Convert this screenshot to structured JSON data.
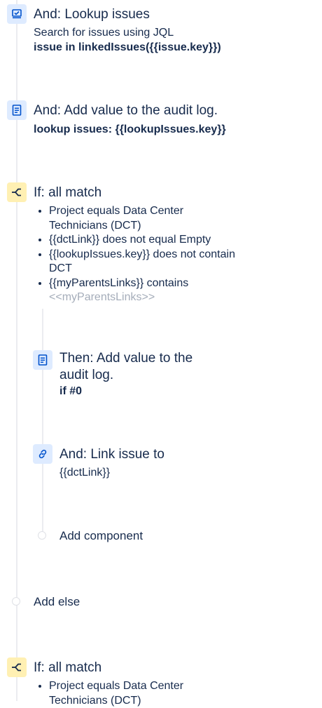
{
  "blocks": {
    "lookup": {
      "title": "And: Lookup issues",
      "subtitle": "Search for issues using JQL",
      "query": "issue in linkedIssues({{issue.key}})",
      "icon": "lookup-issues-icon"
    },
    "audit1": {
      "title": "And: Add value to the audit log.",
      "value": "lookup issues: {{lookupIssues.key}}",
      "icon": "audit-log-icon"
    },
    "if1": {
      "title": "If: all match",
      "icon": "branch-condition-icon",
      "conditions": [
        "Project equals Data Center Technicians (DCT)",
        "{{dctLink}} does not equal Empty",
        "{{lookupIssues.key}} does not contain DCT",
        "{{myParentsLinks}} contains"
      ],
      "condition_faded": "<<myParentsLinks>>"
    },
    "audit2": {
      "title_line1": "Then: Add value to the",
      "title_line2": "audit log.",
      "value": "if #0",
      "icon": "audit-log-icon"
    },
    "link": {
      "title": "And: Link issue to",
      "value": "{{dctLink}}",
      "icon": "link-icon"
    },
    "add_component": {
      "label": "Add component"
    },
    "add_else": {
      "label": "Add else"
    },
    "if2": {
      "title": "If: all match",
      "icon": "branch-condition-icon",
      "conditions": [
        "Project equals Data Center Technicians (DCT)"
      ]
    }
  },
  "colors": {
    "text": "#172b4d",
    "icon_blue_bg": "#deebff",
    "icon_blue_fg": "#0052cc",
    "icon_yellow_bg": "#fff0b3",
    "icon_yellow_fg": "#172b4d",
    "line": "#ebecf0",
    "faded": "#a5adba"
  }
}
